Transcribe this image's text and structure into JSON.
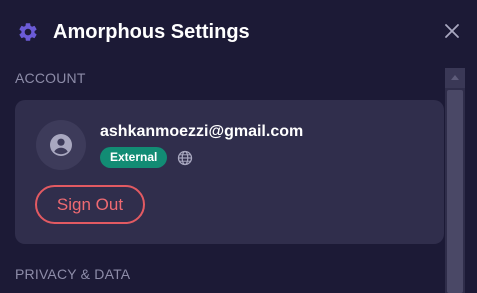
{
  "header": {
    "title": "Amorphous Settings",
    "settings_icon": "gear-icon",
    "close_icon": "close-icon"
  },
  "sections": {
    "account_label": "ACCOUNT",
    "privacy_label": "PRIVACY & DATA"
  },
  "account": {
    "avatar_icon": "user-avatar-icon",
    "email": "ashkanmoezzi@gmail.com",
    "badge": "External",
    "globe_icon": "globe-icon",
    "sign_out_label": "Sign Out"
  },
  "scrollbar": {
    "up_icon": "scroll-up-arrow-icon"
  },
  "colors": {
    "background": "#1c1a36",
    "card": "#302e4c",
    "accent_purple": "#6b5bd6",
    "badge_green": "#128c74",
    "danger": "#e25a62",
    "muted_text": "#8d8ca8"
  }
}
